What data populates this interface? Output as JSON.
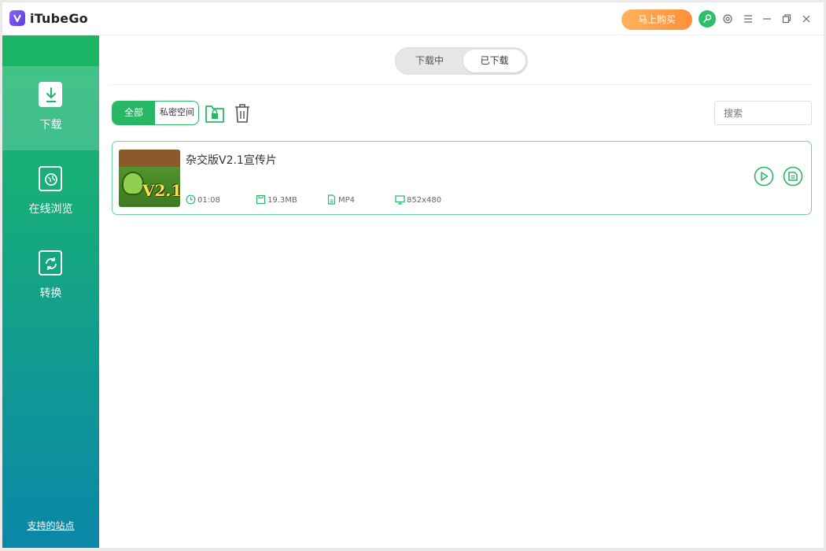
{
  "app": {
    "title": "iTubeGo",
    "logo_icon": "itubego-logo-icon",
    "accent": "#27b765"
  },
  "titlebar": {
    "buy_label": "马上购买",
    "icons": [
      "key-icon",
      "gear-icon",
      "menu-icon",
      "minimize-icon",
      "restore-icon",
      "close-icon"
    ]
  },
  "sidebar": {
    "items": [
      {
        "label": "下载",
        "icon": "download-icon",
        "active": true
      },
      {
        "label": "在线浏览",
        "icon": "browser-icon",
        "active": false
      },
      {
        "label": "转换",
        "icon": "convert-icon",
        "active": false
      }
    ],
    "footer_link": "支持的站点"
  },
  "main": {
    "tabs": [
      {
        "label": "下载中",
        "active": false
      },
      {
        "label": "已下载",
        "active": true
      }
    ],
    "filter": {
      "all_label": "全部",
      "private_label": "私密空间"
    },
    "search": {
      "placeholder": "搜索"
    },
    "items": [
      {
        "title": "杂交版V2.1宣传片",
        "thumb_text": "V2.1",
        "duration": "01:08",
        "size": "19.3MB",
        "format": "MP4",
        "resolution": "852x480"
      }
    ]
  }
}
